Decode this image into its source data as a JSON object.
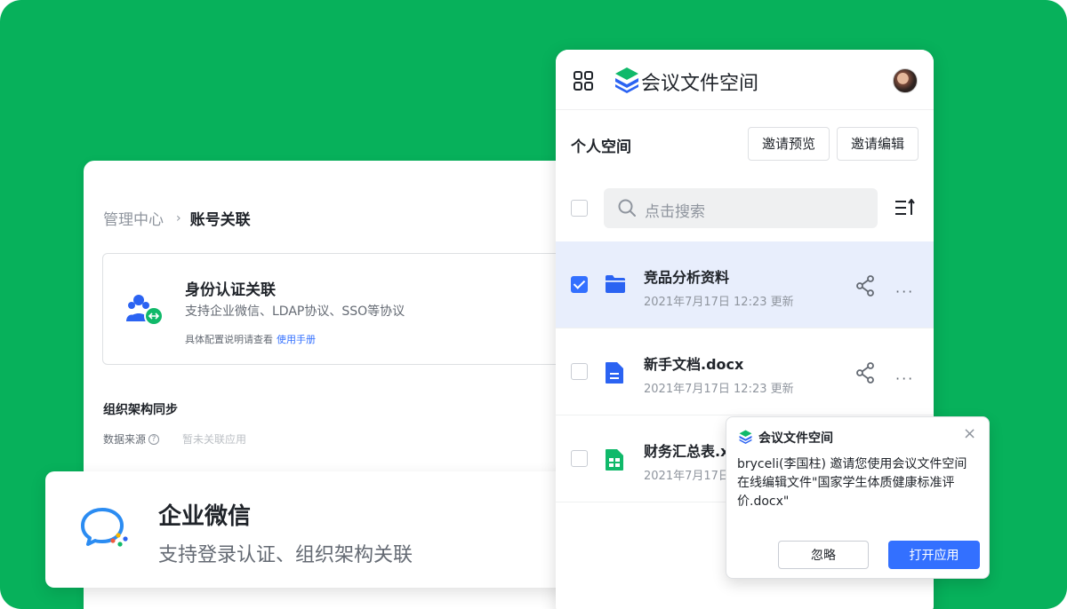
{
  "admin": {
    "breadcrumb_parent": "管理中心",
    "breadcrumb_sep": "›",
    "breadcrumb_current": "账号关联",
    "auth": {
      "title": "身份认证关联",
      "desc": "支持企业微信、LDAP协议、SSO等协议",
      "note": "具体配置说明请查看",
      "link": "使用手册"
    },
    "org_title": "组织架构同步",
    "data_source_label": "数据来源",
    "data_source_help": "?",
    "data_source_value": "暂未关联应用"
  },
  "wecom": {
    "title": "企业微信",
    "desc": "支持登录认证、组织架构关联"
  },
  "space": {
    "title": "会议文件空间",
    "personal_title": "个人空间",
    "invite_preview": "邀请预览",
    "invite_edit": "邀请编辑",
    "search_placeholder": "点击搜索",
    "files": [
      {
        "name": "竞品分析资料",
        "meta": "2021年7月17日 12:23 更新",
        "type": "folder",
        "checked": true
      },
      {
        "name": "新手文档.docx",
        "meta": "2021年7月17日 12:23 更新",
        "type": "doc",
        "checked": false
      },
      {
        "name": "财务汇总表.x",
        "meta": "2021年7月17日 12:23 更新",
        "type": "sheet",
        "checked": false
      }
    ],
    "more": "···"
  },
  "notification": {
    "title": "会议文件空间",
    "close": "×",
    "line1": "bryceli(李国柱) 邀请您使用会议文件空间",
    "line2": "在线编辑文件\"国家学生体质健康标准评价.docx\"",
    "ignore": "忽略",
    "open": "打开应用"
  },
  "colors": {
    "background": "#07b15b",
    "accent": "#3370ff",
    "selected_row": "#e8eefc",
    "sheet_green": "#10b96a"
  }
}
